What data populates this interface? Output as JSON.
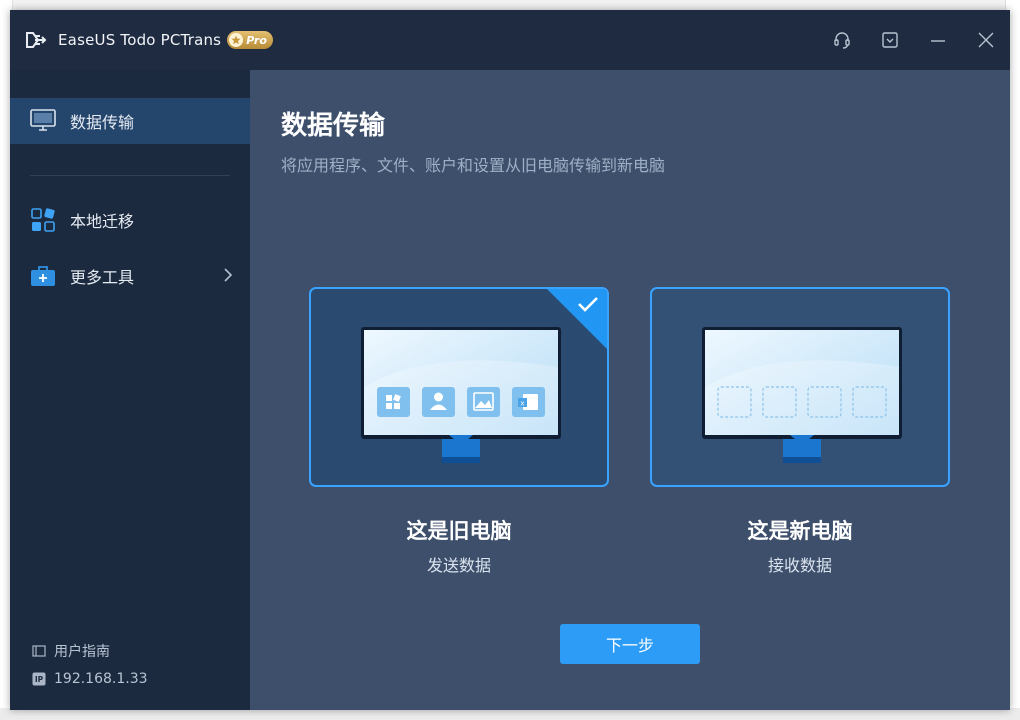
{
  "app": {
    "title": "EaseUS Todo PCTrans",
    "badge": "Pro"
  },
  "titlebar": {
    "icons": [
      "headset-icon",
      "download-icon",
      "minimize-icon",
      "close-icon"
    ]
  },
  "sidebar": {
    "items": [
      {
        "label": "数据传输",
        "icon": "monitor-icon",
        "active": true
      },
      {
        "label": "本地迁移",
        "icon": "apps-grid-icon",
        "active": false
      },
      {
        "label": "更多工具",
        "icon": "toolbox-icon",
        "active": false
      }
    ],
    "footer": {
      "guide_label": "用户指南",
      "ip": "192.168.1.33",
      "ip_badge": "IP"
    }
  },
  "main": {
    "title": "数据传输",
    "subtitle": "将应用程序、文件、账户和设置从旧电脑传输到新电脑",
    "cards": [
      {
        "title": "这是旧电脑",
        "subtitle": "发送数据",
        "selected": true
      },
      {
        "title": "这是新电脑",
        "subtitle": "接收数据",
        "selected": false
      }
    ],
    "next_button": "下一步"
  },
  "colors": {
    "accent": "#2d9cf7",
    "card_border": "#3aa3ff",
    "sidebar_bg": "#1b2a3f",
    "main_bg": "#3d4f6b",
    "titlebar_bg": "#1e2b40"
  }
}
